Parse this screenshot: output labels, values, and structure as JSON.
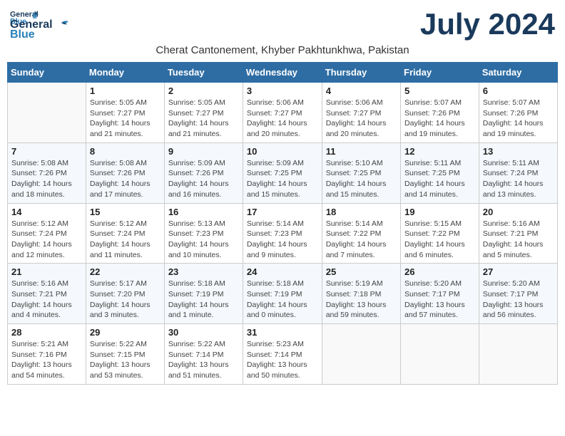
{
  "header": {
    "logo_line1": "General",
    "logo_line2": "Blue",
    "month_title": "July 2024",
    "subtitle": "Cherat Cantonement, Khyber Pakhtunkhwa, Pakistan"
  },
  "weekdays": [
    "Sunday",
    "Monday",
    "Tuesday",
    "Wednesday",
    "Thursday",
    "Friday",
    "Saturday"
  ],
  "weeks": [
    [
      {
        "day": "",
        "info": ""
      },
      {
        "day": "1",
        "info": "Sunrise: 5:05 AM\nSunset: 7:27 PM\nDaylight: 14 hours\nand 21 minutes."
      },
      {
        "day": "2",
        "info": "Sunrise: 5:05 AM\nSunset: 7:27 PM\nDaylight: 14 hours\nand 21 minutes."
      },
      {
        "day": "3",
        "info": "Sunrise: 5:06 AM\nSunset: 7:27 PM\nDaylight: 14 hours\nand 20 minutes."
      },
      {
        "day": "4",
        "info": "Sunrise: 5:06 AM\nSunset: 7:27 PM\nDaylight: 14 hours\nand 20 minutes."
      },
      {
        "day": "5",
        "info": "Sunrise: 5:07 AM\nSunset: 7:26 PM\nDaylight: 14 hours\nand 19 minutes."
      },
      {
        "day": "6",
        "info": "Sunrise: 5:07 AM\nSunset: 7:26 PM\nDaylight: 14 hours\nand 19 minutes."
      }
    ],
    [
      {
        "day": "7",
        "info": "Sunrise: 5:08 AM\nSunset: 7:26 PM\nDaylight: 14 hours\nand 18 minutes."
      },
      {
        "day": "8",
        "info": "Sunrise: 5:08 AM\nSunset: 7:26 PM\nDaylight: 14 hours\nand 17 minutes."
      },
      {
        "day": "9",
        "info": "Sunrise: 5:09 AM\nSunset: 7:26 PM\nDaylight: 14 hours\nand 16 minutes."
      },
      {
        "day": "10",
        "info": "Sunrise: 5:09 AM\nSunset: 7:25 PM\nDaylight: 14 hours\nand 15 minutes."
      },
      {
        "day": "11",
        "info": "Sunrise: 5:10 AM\nSunset: 7:25 PM\nDaylight: 14 hours\nand 15 minutes."
      },
      {
        "day": "12",
        "info": "Sunrise: 5:11 AM\nSunset: 7:25 PM\nDaylight: 14 hours\nand 14 minutes."
      },
      {
        "day": "13",
        "info": "Sunrise: 5:11 AM\nSunset: 7:24 PM\nDaylight: 14 hours\nand 13 minutes."
      }
    ],
    [
      {
        "day": "14",
        "info": "Sunrise: 5:12 AM\nSunset: 7:24 PM\nDaylight: 14 hours\nand 12 minutes."
      },
      {
        "day": "15",
        "info": "Sunrise: 5:12 AM\nSunset: 7:24 PM\nDaylight: 14 hours\nand 11 minutes."
      },
      {
        "day": "16",
        "info": "Sunrise: 5:13 AM\nSunset: 7:23 PM\nDaylight: 14 hours\nand 10 minutes."
      },
      {
        "day": "17",
        "info": "Sunrise: 5:14 AM\nSunset: 7:23 PM\nDaylight: 14 hours\nand 9 minutes."
      },
      {
        "day": "18",
        "info": "Sunrise: 5:14 AM\nSunset: 7:22 PM\nDaylight: 14 hours\nand 7 minutes."
      },
      {
        "day": "19",
        "info": "Sunrise: 5:15 AM\nSunset: 7:22 PM\nDaylight: 14 hours\nand 6 minutes."
      },
      {
        "day": "20",
        "info": "Sunrise: 5:16 AM\nSunset: 7:21 PM\nDaylight: 14 hours\nand 5 minutes."
      }
    ],
    [
      {
        "day": "21",
        "info": "Sunrise: 5:16 AM\nSunset: 7:21 PM\nDaylight: 14 hours\nand 4 minutes."
      },
      {
        "day": "22",
        "info": "Sunrise: 5:17 AM\nSunset: 7:20 PM\nDaylight: 14 hours\nand 3 minutes."
      },
      {
        "day": "23",
        "info": "Sunrise: 5:18 AM\nSunset: 7:19 PM\nDaylight: 14 hours\nand 1 minute."
      },
      {
        "day": "24",
        "info": "Sunrise: 5:18 AM\nSunset: 7:19 PM\nDaylight: 14 hours\nand 0 minutes."
      },
      {
        "day": "25",
        "info": "Sunrise: 5:19 AM\nSunset: 7:18 PM\nDaylight: 13 hours\nand 59 minutes."
      },
      {
        "day": "26",
        "info": "Sunrise: 5:20 AM\nSunset: 7:17 PM\nDaylight: 13 hours\nand 57 minutes."
      },
      {
        "day": "27",
        "info": "Sunrise: 5:20 AM\nSunset: 7:17 PM\nDaylight: 13 hours\nand 56 minutes."
      }
    ],
    [
      {
        "day": "28",
        "info": "Sunrise: 5:21 AM\nSunset: 7:16 PM\nDaylight: 13 hours\nand 54 minutes."
      },
      {
        "day": "29",
        "info": "Sunrise: 5:22 AM\nSunset: 7:15 PM\nDaylight: 13 hours\nand 53 minutes."
      },
      {
        "day": "30",
        "info": "Sunrise: 5:22 AM\nSunset: 7:14 PM\nDaylight: 13 hours\nand 51 minutes."
      },
      {
        "day": "31",
        "info": "Sunrise: 5:23 AM\nSunset: 7:14 PM\nDaylight: 13 hours\nand 50 minutes."
      },
      {
        "day": "",
        "info": ""
      },
      {
        "day": "",
        "info": ""
      },
      {
        "day": "",
        "info": ""
      }
    ]
  ]
}
